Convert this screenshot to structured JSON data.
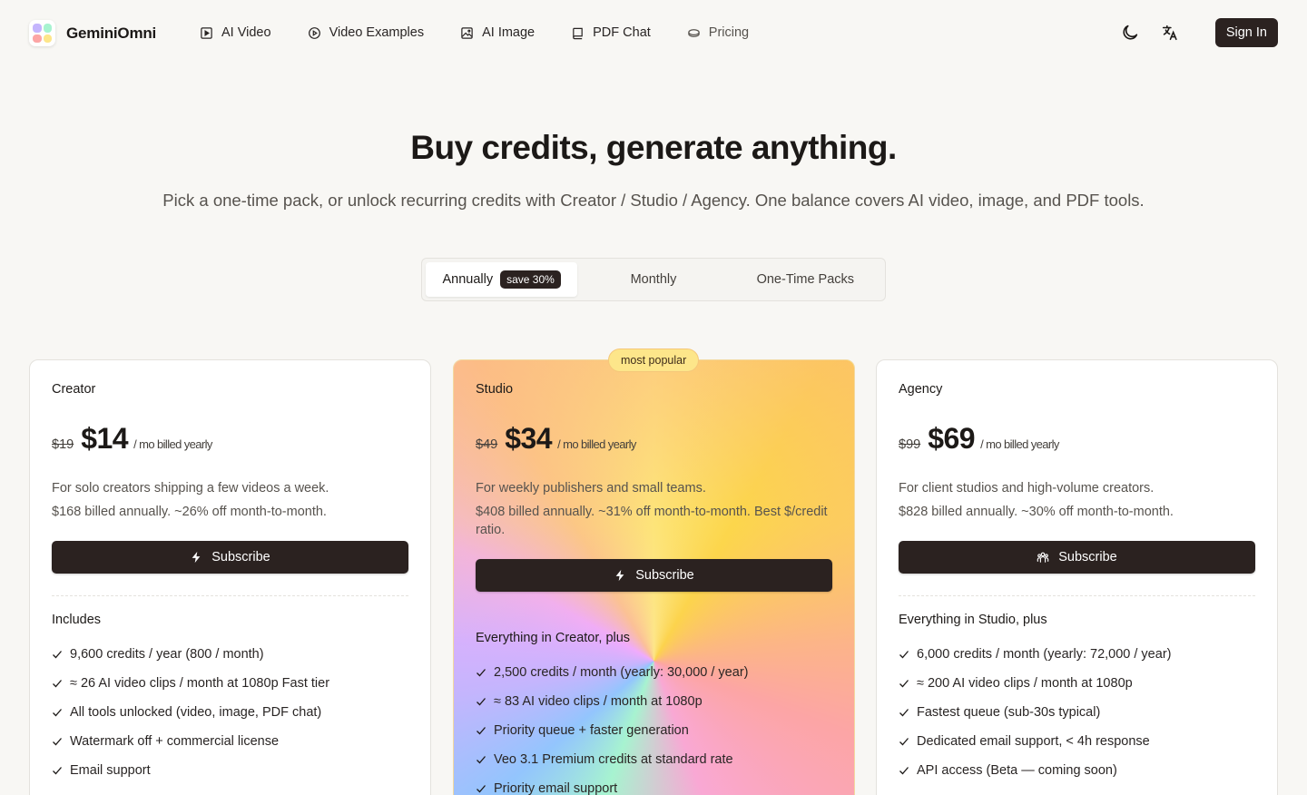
{
  "nav": {
    "brand": "GeminiOmni",
    "links": [
      {
        "label": "AI Video",
        "icon": "video-square-icon"
      },
      {
        "label": "Video Examples",
        "icon": "play-circle-icon"
      },
      {
        "label": "AI Image",
        "icon": "image-icon"
      },
      {
        "label": "PDF Chat",
        "icon": "book-icon"
      },
      {
        "label": "Pricing",
        "icon": "coin-icon"
      }
    ],
    "sign_in": "Sign In"
  },
  "hero": {
    "title": "Buy credits, generate anything.",
    "subtitle": "Pick a one-time pack, or unlock recurring credits with Creator / Studio / Agency. One balance covers AI video, image, and PDF tools."
  },
  "billing_toggle": {
    "options": [
      "Annually",
      "Monthly",
      "One-Time Packs"
    ],
    "selected": "Annually",
    "save_badge": "save 30%"
  },
  "plans": [
    {
      "name": "Creator",
      "old_price": "$19",
      "price": "$14",
      "period": "/ mo billed yearly",
      "description": "For solo creators shipping a few videos a week.",
      "billing_note": "$168 billed annually. ~26% off month-to-month.",
      "cta": "Subscribe",
      "features_heading": "Includes",
      "features": [
        "9,600 credits / year (800 / month)",
        "≈ 26 AI video clips / month at 1080p Fast tier",
        "All tools unlocked (video, image, PDF chat)",
        "Watermark off + commercial license",
        "Email support"
      ]
    },
    {
      "name": "Studio",
      "badge": "most popular",
      "old_price": "$49",
      "price": "$34",
      "period": "/ mo billed yearly",
      "description": "For weekly publishers and small teams.",
      "billing_note": "$408 billed annually. ~31% off month-to-month. Best $/credit ratio.",
      "cta": "Subscribe",
      "features_heading": "Everything in Creator, plus",
      "features": [
        "2,500 credits / month (yearly: 30,000 / year)",
        "≈ 83 AI video clips / month at 1080p",
        "Priority queue + faster generation",
        "Veo 3.1 Premium credits at standard rate",
        "Priority email support"
      ]
    },
    {
      "name": "Agency",
      "old_price": "$99",
      "price": "$69",
      "period": "/ mo billed yearly",
      "description": "For client studios and high-volume creators.",
      "billing_note": "$828 billed annually. ~30% off month-to-month.",
      "cta": "Subscribe",
      "features_heading": "Everything in Studio, plus",
      "features": [
        "6,000 credits / month (yearly: 72,000 / year)",
        "≈ 200 AI video clips / month at 1080p",
        "Fastest queue (sub-30s typical)",
        "Dedicated email support, < 4h response",
        "API access (Beta — coming soon)"
      ]
    }
  ],
  "colors": {
    "background": "#f8f7f4",
    "primary_button": "#2b2220",
    "popular_badge": "#fde68a"
  }
}
